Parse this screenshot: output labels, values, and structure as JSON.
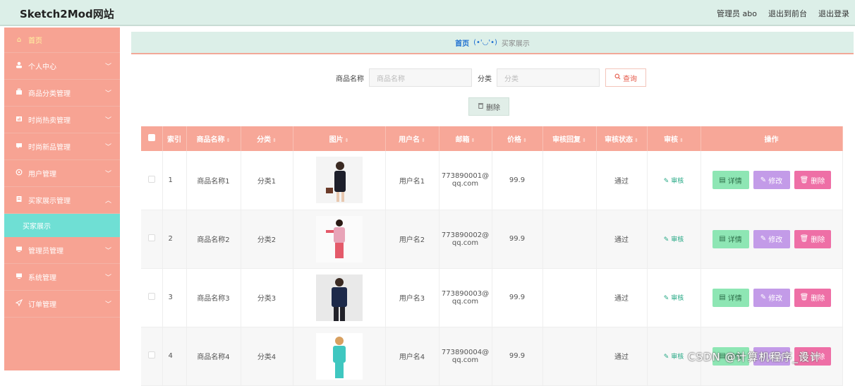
{
  "header": {
    "logo": "Sketch2Mod网站",
    "user": "管理员 abo",
    "to_front": "退出到前台",
    "logout": "退出登录"
  },
  "sidebar": {
    "items": [
      {
        "label": "首页",
        "icon": "home-icon",
        "glyph": "⌂"
      },
      {
        "label": "个人中心",
        "icon": "user-icon",
        "glyph": "👤"
      },
      {
        "label": "商品分类管理",
        "icon": "briefcase-icon",
        "glyph": "▬"
      },
      {
        "label": "时尚热卖管理",
        "icon": "bar-chart-icon",
        "glyph": "▮"
      },
      {
        "label": "时尚新品管理",
        "icon": "message-icon",
        "glyph": "▬"
      },
      {
        "label": "用户管理",
        "icon": "settings-icon",
        "glyph": "◎"
      },
      {
        "label": "买家展示管理",
        "icon": "document-icon",
        "glyph": "▤"
      },
      {
        "label": "买家展示",
        "icon": "",
        "glyph": ""
      },
      {
        "label": "管理员管理",
        "icon": "monitor-icon",
        "glyph": "▭"
      },
      {
        "label": "系统管理",
        "icon": "monitor-icon",
        "glyph": "▭"
      },
      {
        "label": "订单管理",
        "icon": "send-icon",
        "glyph": "◁"
      }
    ]
  },
  "breadcrumb": {
    "home": "首页",
    "face": "(•'◡'•)",
    "current": "买家展示"
  },
  "search": {
    "name_label": "商品名称",
    "name_placeholder": "商品名称",
    "category_label": "分类",
    "category_placeholder": "分类",
    "query_label": "查询"
  },
  "batch_delete_label": "删除",
  "table": {
    "headers": [
      "索引",
      "商品名称",
      "分类",
      "图片",
      "用户名",
      "邮箱",
      "价格",
      "审核回复",
      "审核状态",
      "审核",
      "操作"
    ],
    "rows": [
      {
        "index": "1",
        "name": "商品名称1",
        "category": "分类1",
        "image": "woman-in-black-dress",
        "user": "用户名1",
        "email_1": "773890001@",
        "email_2": "qq.com",
        "price": "99.9",
        "reply": "",
        "status": "通过",
        "audit": "审核"
      },
      {
        "index": "2",
        "name": "商品名称2",
        "category": "分类2",
        "image": "girl-in-pink-outfit",
        "user": "用户名2",
        "email_1": "773890002@",
        "email_2": "qq.com",
        "price": "99.9",
        "reply": "",
        "status": "通过",
        "audit": "审核"
      },
      {
        "index": "3",
        "name": "商品名称3",
        "category": "分类3",
        "image": "man-in-navy-shirt",
        "user": "用户名3",
        "email_1": "773890003@",
        "email_2": "qq.com",
        "price": "99.9",
        "reply": "",
        "status": "通过",
        "audit": "审核"
      },
      {
        "index": "4",
        "name": "商品名称4",
        "category": "分类4",
        "image": "girl-in-teal-top",
        "user": "用户名4",
        "email_1": "773890004@",
        "email_2": "qq.com",
        "price": "99.9",
        "reply": "",
        "status": "通过",
        "audit": "审核"
      }
    ],
    "actions": {
      "detail": "详情",
      "edit": "修改",
      "delete": "删除"
    }
  },
  "watermark": "CSDN @计算机程序_设计",
  "colors": {
    "sidebar": "#f7a393",
    "active_sub": "#6fdfd4",
    "header_bg": "#dcefe8",
    "table_head": "#f7a798",
    "detail_btn": "#8ee6b4",
    "edit_btn": "#c39be8",
    "delete_btn": "#ee6fa6"
  }
}
